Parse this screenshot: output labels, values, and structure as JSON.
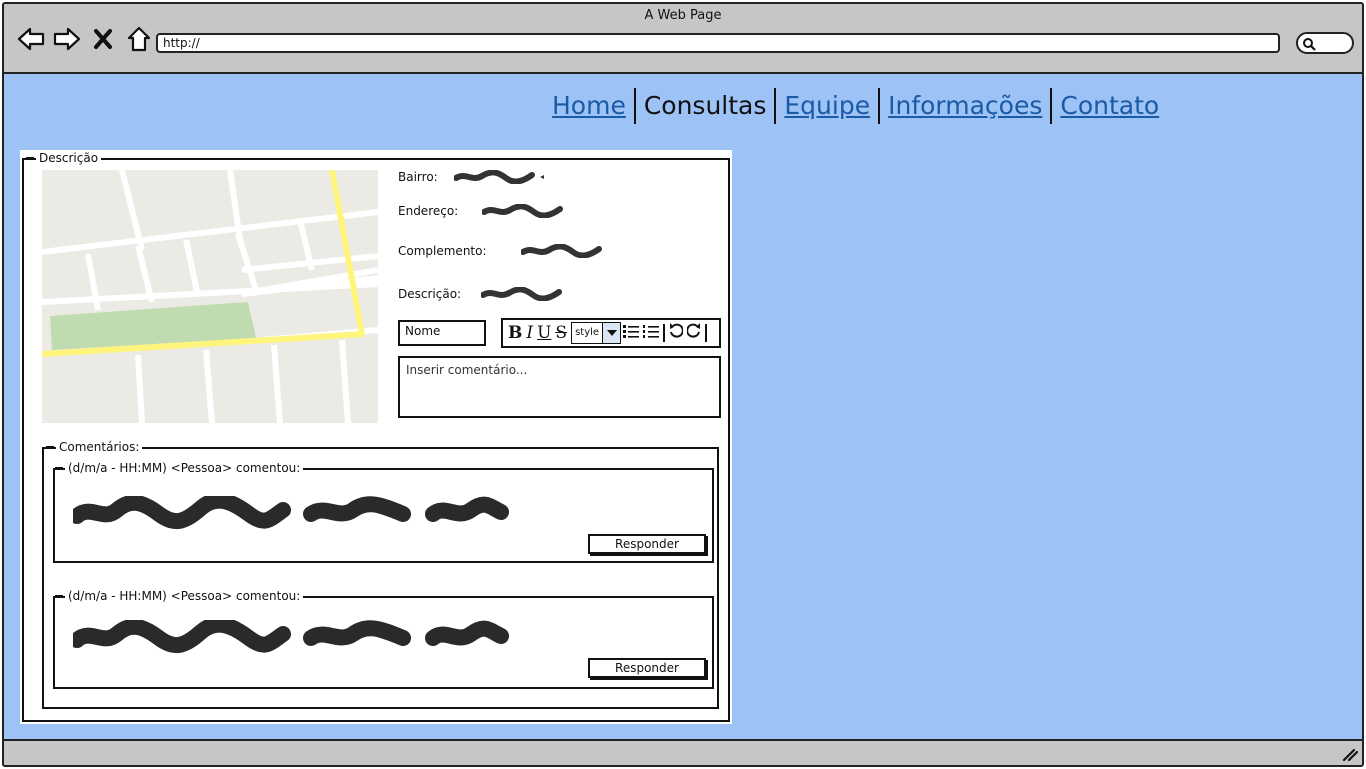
{
  "window": {
    "title": "A Web Page"
  },
  "browser": {
    "url": "http://",
    "icons": [
      "back-icon",
      "forward-icon",
      "close-icon",
      "home-icon",
      "search-icon"
    ]
  },
  "menu": {
    "items": [
      {
        "label": "Home",
        "current": false
      },
      {
        "label": "Consultas",
        "current": true
      },
      {
        "label": "Equipe",
        "current": false
      },
      {
        "label": "Informações",
        "current": false
      },
      {
        "label": "Contato",
        "current": false
      }
    ]
  },
  "description": {
    "legend": "Descrição",
    "fields": {
      "bairro": "Bairro:",
      "endereco": "Endereço:",
      "complemento": "Complemento:",
      "descricao": "Descrição:"
    },
    "name_input": "Nome",
    "editor": {
      "bold": "B",
      "italic": "I",
      "underline": "U",
      "strike": "S",
      "style": "style"
    },
    "comment_placeholder": "Inserir comentário..."
  },
  "comments": {
    "legend": "Comentários:",
    "items": [
      {
        "header": "(d/m/a - HH:MM) <Pessoa> comentou:",
        "reply_label": "Responder"
      },
      {
        "header": "(d/m/a - HH:MM) <Pessoa> comentou:",
        "reply_label": "Responder"
      }
    ]
  },
  "colors": {
    "page_background": "#9dc2f5",
    "link": "#1a5aa6",
    "map_park": "#c1dbb0",
    "map_road": "#fff47c"
  }
}
